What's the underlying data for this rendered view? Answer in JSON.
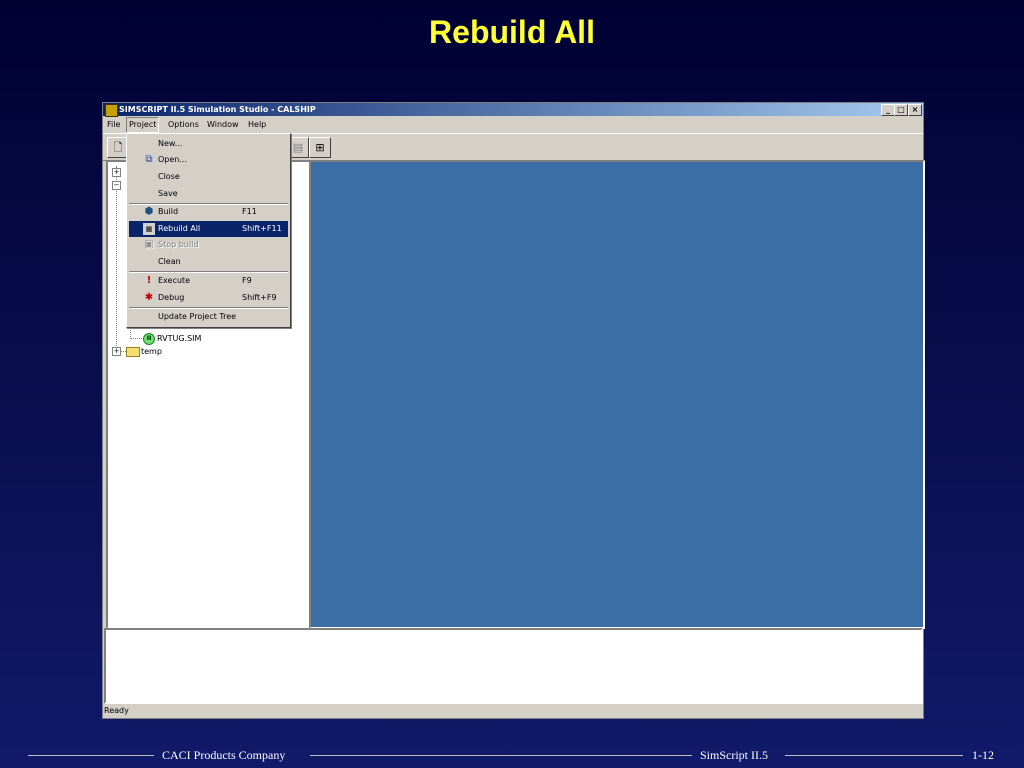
{
  "slide": {
    "title": "Rebuild All"
  },
  "window": {
    "title": "SIMSCRIPT II.5 Simulation Studio - CALSHIP",
    "controls": {
      "minimize": "_",
      "maximize": "□",
      "close": "×"
    }
  },
  "menubar": [
    "File",
    "Project",
    "Options",
    "Window",
    "Help"
  ],
  "project_menu": {
    "items": [
      {
        "label": "New...",
        "shortcut": "",
        "icon": ""
      },
      {
        "label": "Open...",
        "shortcut": "",
        "icon": "open-icon"
      },
      {
        "label": "Close",
        "shortcut": "",
        "icon": ""
      },
      {
        "label": "Save",
        "shortcut": "",
        "icon": ""
      },
      {
        "label": "Build",
        "shortcut": "F11",
        "icon": "build-icon"
      },
      {
        "label": "Rebuild All",
        "shortcut": "Shift+F11",
        "icon": "rebuild-icon",
        "selected": true
      },
      {
        "label": "Stop build",
        "shortcut": "",
        "icon": "stop-build-icon",
        "disabled": true
      },
      {
        "label": "Clean",
        "shortcut": "",
        "icon": ""
      },
      {
        "label": "Execute",
        "shortcut": "F9",
        "icon": "exclamation-icon"
      },
      {
        "label": "Debug",
        "shortcut": "Shift+F9",
        "icon": "bug-icon"
      },
      {
        "label": "Update Project Tree",
        "shortcut": "",
        "icon": ""
      }
    ]
  },
  "tree": {
    "visible_items": [
      {
        "label": "RVTUG.SIM",
        "icon": "sim-file-icon"
      },
      {
        "label": "temp",
        "icon": "folder-icon"
      }
    ]
  },
  "statusbar": {
    "text": "Ready"
  },
  "footer": {
    "company": "CACI Products Company",
    "product": "SimScript II.5",
    "page": "1-12"
  },
  "colors": {
    "title": "#ffff33",
    "workspace": "#3a6ea5",
    "selection": "#0a246a"
  }
}
